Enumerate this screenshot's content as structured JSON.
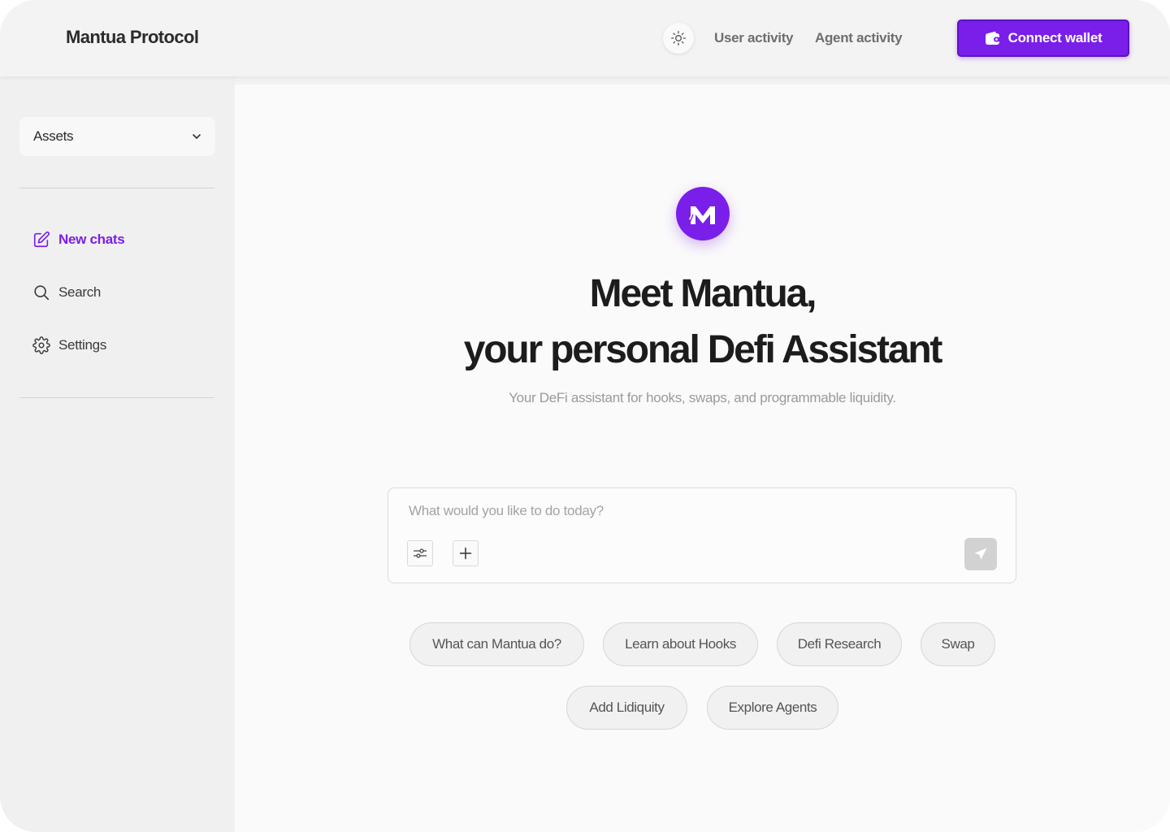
{
  "header": {
    "brand": "Mantua Protocol",
    "theme_icon": "sun-icon",
    "nav": [
      {
        "label": "User activity"
      },
      {
        "label": "Agent activity"
      }
    ],
    "connect_label": "Connect wallet",
    "connect_icon": "wallet-icon"
  },
  "sidebar": {
    "assets_label": "Assets",
    "items": [
      {
        "label": "New chats",
        "icon": "edit-icon",
        "active": true
      },
      {
        "label": "Search",
        "icon": "search-icon"
      },
      {
        "label": "Settings",
        "icon": "gear-icon"
      }
    ]
  },
  "main": {
    "logo_icon": "mantua-logo-icon",
    "headline_line1": "Meet Mantua,",
    "headline_line2": "your personal Defi Assistant",
    "subtitle": "Your DeFi assistant for hooks, swaps, and programmable liquidity.",
    "chat": {
      "placeholder": "What would you like to do today?",
      "value": ""
    },
    "suggestions": [
      {
        "label": "What can Mantua do?"
      },
      {
        "label": "Learn about Hooks"
      },
      {
        "label": "Defi Research"
      },
      {
        "label": "Swap"
      },
      {
        "label": "Add Lidiquity"
      },
      {
        "label": "Explore Agents"
      }
    ]
  },
  "colors": {
    "accent": "#7a1fe9",
    "background": "#fafafa",
    "sidebar": "#f0f0f0"
  }
}
